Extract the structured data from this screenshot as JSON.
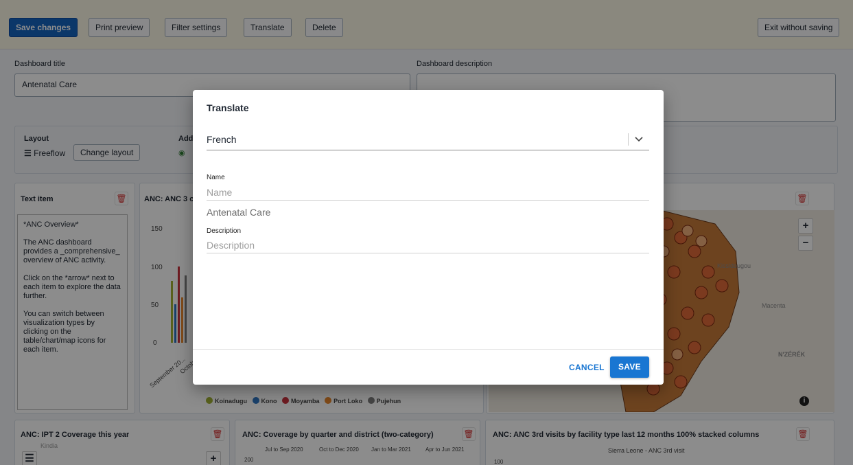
{
  "toolbar": {
    "save_changes": "Save changes",
    "print_preview": "Print preview",
    "filter_settings": "Filter settings",
    "translate": "Translate",
    "delete": "Delete",
    "exit_without_saving": "Exit without saving"
  },
  "dashboard": {
    "title_label": "Dashboard title",
    "title_value": "Antenatal Care",
    "description_label": "Dashboard description",
    "layout_label": "Layout",
    "layout_value": "Freeflow",
    "change_layout": "Change layout",
    "add_label": "Add"
  },
  "items": {
    "text_item_title": "Text item",
    "text_item_body": [
      "*ANC Overview*",
      "The ANC dashboard provides a _comprehensive_ overview of ANC activity.",
      "Click on the *arrow* next to each item to explore the data further.",
      "You can switch between visualization types by clicking on the table/chart/map icons for each item."
    ],
    "anc3_title": "ANC: ANC 3 c",
    "anc3_yticks": [
      "150",
      "100",
      "50",
      "0"
    ],
    "anc3_xticks": [
      "September 20...",
      "October"
    ],
    "legend": [
      "Koinadugu",
      "Kono",
      "Moyamba",
      "Port Loko",
      "Pujehun"
    ],
    "legend_colors": [
      "#a0b033",
      "#2e76c2",
      "#c8323c",
      "#e8882c",
      "#7d7d7d"
    ],
    "map_labels": [
      "Kissidougou",
      "Macenta",
      "N'ZÉRÉK"
    ],
    "ipt2_title": "ANC: IPT 2 Coverage this year",
    "ipt2_map_label": "Kindia",
    "coverage_title": "ANC: Coverage by quarter and district (two-category)",
    "coverage_columns": [
      "Jul to Sep 2020",
      "Oct to Dec 2020",
      "Jan to Mar 2021",
      "Apr to Jun 2021"
    ],
    "coverage_ytick": "200",
    "facility_title": "ANC: ANC 3rd visits by facility type last 12 months 100% stacked columns",
    "facility_subtitle": "Sierra Leone - ANC 3rd visit",
    "facility_ytick": "100"
  },
  "modal": {
    "title": "Translate",
    "language": "French",
    "name_label": "Name",
    "name_placeholder": "Name",
    "name_original": "Antenatal Care",
    "description_label": "Description",
    "description_placeholder": "Description",
    "cancel": "CANCEL",
    "save": "SAVE"
  },
  "colors": {
    "primary": "#1976d2",
    "toolbar_bg": "#fbf7e6",
    "danger": "#d32f2f"
  }
}
